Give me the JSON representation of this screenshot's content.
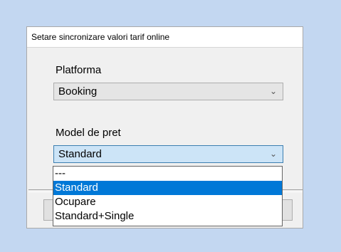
{
  "dialog": {
    "title": "Setare sincronizare valori tarif online"
  },
  "platform": {
    "label": "Platforma",
    "value": "Booking"
  },
  "price_model": {
    "label": "Model de pret",
    "value": "Standard",
    "options": [
      "---",
      "Standard",
      "Ocupare",
      "Standard+Single"
    ],
    "selected_index": 1
  },
  "icons": {
    "chevron": "chevron-down-icon"
  },
  "colors": {
    "background": "#c3d7f1",
    "highlight": "#0078d7",
    "focused_select": "#cce4f7"
  }
}
